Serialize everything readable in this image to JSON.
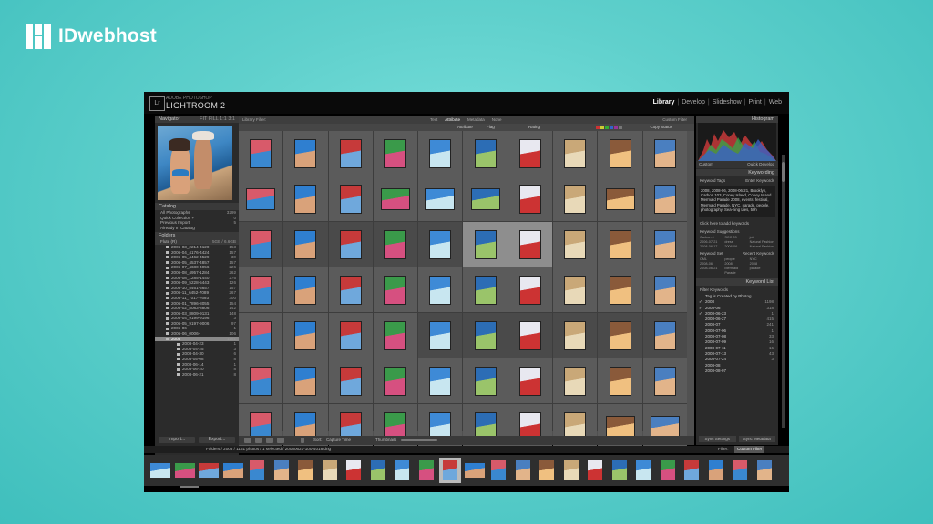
{
  "brand": {
    "name": "IDwebhost"
  },
  "app": {
    "logo": "Lr",
    "product_small": "ADOBE PHOTOSHOP",
    "product": "LIGHTROOM 2",
    "modules": [
      "Library",
      "Develop",
      "Slideshow",
      "Print",
      "Web"
    ],
    "active_module": "Library"
  },
  "left_panel": {
    "navigator": {
      "title": "Navigator",
      "zoom": [
        "FIT",
        "FILL",
        "1:1",
        "3:1"
      ]
    },
    "catalog": {
      "title": "Catalog",
      "items": [
        {
          "label": "All Photographs",
          "count": "3299"
        },
        {
          "label": "Quick Collection +",
          "count": "0"
        },
        {
          "label": "Previous Import",
          "count": "5"
        },
        {
          "label": "Already In Catalog",
          "count": ""
        }
      ]
    },
    "folders": {
      "title": "Folders",
      "volume": "Flute (R)",
      "volume_info": "5GB / 6.6GB",
      "items": [
        {
          "label": "2006-03_2214-4120",
          "count": "153"
        },
        {
          "label": "2006-04_4176-4424",
          "count": "157"
        },
        {
          "label": "2006-05_4462-4529",
          "count": "30"
        },
        {
          "label": "2006-05_4537-4857",
          "count": "157"
        },
        {
          "label": "2006-07_4680-4956",
          "count": "226"
        },
        {
          "label": "2006-08_4957-1284",
          "count": "262"
        },
        {
          "label": "2006-08_1285-1440",
          "count": "276"
        },
        {
          "label": "2006-09_5228-5443",
          "count": "126"
        },
        {
          "label": "2006-10_5461-5657",
          "count": "157"
        },
        {
          "label": "2006-11_6452-7089",
          "count": "267"
        },
        {
          "label": "2006-11_7017-7693",
          "count": "300"
        },
        {
          "label": "2006-01_7896-8055",
          "count": "154"
        },
        {
          "label": "2006-02_8083-8806",
          "count": "142"
        },
        {
          "label": "2006-03_8809-9131",
          "count": "148"
        },
        {
          "label": "2006-04_9199-9196",
          "count": "3"
        },
        {
          "label": "2006-05_9197-9006",
          "count": "97"
        },
        {
          "label": "2006-06",
          "count": "1"
        },
        {
          "label": "2006-06_0006-",
          "count": "106"
        }
      ],
      "selected": {
        "label": "2008",
        "count": "1161"
      },
      "children": [
        {
          "label": "2008-04-23",
          "count": "1"
        },
        {
          "label": "2008-04-25",
          "count": "3"
        },
        {
          "label": "2008-04-30",
          "count": "6"
        },
        {
          "label": "2008-05-08",
          "count": "8"
        },
        {
          "label": "2008-06-14",
          "count": "1"
        },
        {
          "label": "2008-06-20",
          "count": "8"
        },
        {
          "label": "2008-06-21",
          "count": "8"
        }
      ]
    },
    "buttons": {
      "import": "Import...",
      "export": "Export..."
    }
  },
  "center": {
    "filter_title": "Library Filter:",
    "filter_tabs": [
      "Text",
      "Attribute",
      "Metadata",
      "None"
    ],
    "filter_preset": "Custom Filter",
    "attr_labels": {
      "attribute": "Attribute",
      "flag": "Flag",
      "rating": "Rating",
      "kind": "Kind",
      "copy": "Copy Status"
    },
    "toolbar": {
      "sort_label": "Sort:",
      "sort_value": "Capture Time",
      "thumbnails": "Thumbnails"
    }
  },
  "right_panel": {
    "histogram": "Histogram",
    "quick_develop": "Quick Develop",
    "quick_develop_preset": "Custom",
    "keywording": "Keywording",
    "keyword_tags_label": "Keyword Tags",
    "keyword_tags_mode": "Enter Keywords",
    "keyword_text": "2008, 2008-06, 2008-06-21, Brooklyn, Carbon 103, Coney Island, Coney Island Mermaid Parade 2008, events, festival, Mermaid Parade, NYC, parade, people, photography, Sea-ning Lies, 50h",
    "click_here": "Click here to add keywords",
    "suggestions_label": "Keyword Suggestions",
    "suggestions": [
      "Carbon 4",
      "SCC 03",
      "job",
      "2006-07-21",
      "dress",
      "Natural Fashion",
      "2008-06-17",
      "2006-06",
      "Natural Fashion"
    ],
    "keyword_set_label": "Keyword Set",
    "keyword_set_value": "Recent Keywords",
    "keyword_set": [
      "CML",
      "people",
      "NYC",
      "2008-06",
      "2008",
      "2008",
      "2008-06-21",
      "Mermaid Parade",
      "parade"
    ],
    "keyword_list": "Keyword List",
    "filter_keywords": "Filter Keywords",
    "list": [
      {
        "label": "Tag is Created by Photog",
        "count": "",
        "checked": false
      },
      {
        "label": "2008",
        "count": "1198",
        "checked": true
      },
      {
        "label": "2008-06",
        "count": "318",
        "checked": true
      },
      {
        "label": "2008-06-23",
        "count": "1",
        "checked": true
      },
      {
        "label": "2008-06-27",
        "count": "415",
        "checked": false
      },
      {
        "label": "2008-07",
        "count": "241",
        "checked": false
      },
      {
        "label": "2008-07-06",
        "count": "1",
        "checked": false
      },
      {
        "label": "2008-07-08",
        "count": "33",
        "checked": false
      },
      {
        "label": "2008-07-09",
        "count": "16",
        "checked": false
      },
      {
        "label": "2008-07-11",
        "count": "16",
        "checked": false
      },
      {
        "label": "2008-07-13",
        "count": "43",
        "checked": false
      },
      {
        "label": "2008-07-24",
        "count": "3",
        "checked": false
      },
      {
        "label": "2008-08",
        "count": "",
        "checked": false
      },
      {
        "label": "2008-08-07",
        "count": "",
        "checked": false
      }
    ],
    "buttons": {
      "sync_settings": "Sync Settings",
      "sync_metadata": "Sync Metadata"
    }
  },
  "filmstrip": {
    "path": "Folders / 2008 / 1161 photos / 1 selected / 20080621-100-4018.dng",
    "filter_label": "Filter:",
    "filter_value": "Custom Filter"
  },
  "colors": {
    "accent": "#3fbfbd",
    "panel": "#2b2b2b",
    "grid": "#515151"
  }
}
